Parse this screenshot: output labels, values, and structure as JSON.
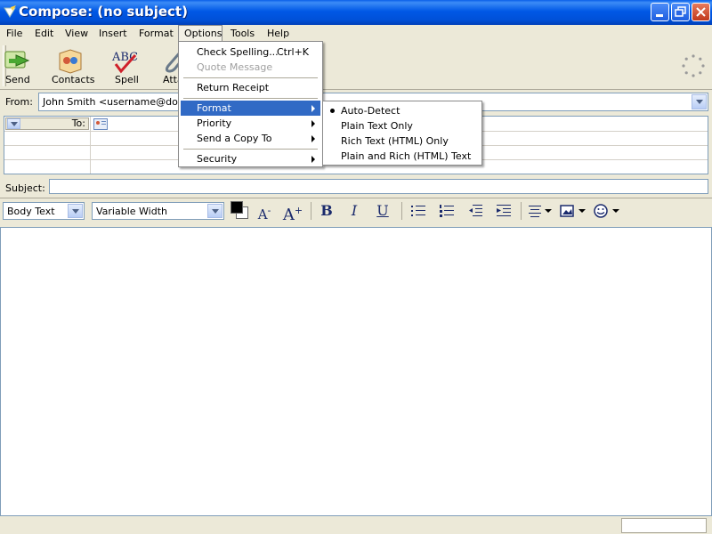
{
  "window": {
    "title": "Compose: (no subject)"
  },
  "menubar": [
    "File",
    "Edit",
    "View",
    "Insert",
    "Format",
    "Options",
    "Tools",
    "Help"
  ],
  "toolbar": {
    "send": "Send",
    "contacts": "Contacts",
    "spell": "Spell",
    "attach": "Atta"
  },
  "from": {
    "label": "From:",
    "value": "John Smith <username@domain"
  },
  "recipients": {
    "type": "To:"
  },
  "subject": {
    "label": "Subject:",
    "value": ""
  },
  "format_bar": {
    "paragraph_style": "Body Text",
    "font": "Variable Width",
    "bold": "B",
    "italic": "I",
    "underline": "U",
    "smaller_text": "A",
    "larger_text": "A"
  },
  "options_menu": {
    "check_spelling": "Check Spelling...",
    "check_spelling_shortcut": "Ctrl+K",
    "quote_message": "Quote Message",
    "return_receipt": "Return Receipt",
    "format": "Format",
    "priority": "Priority",
    "send_copy_to": "Send a Copy To",
    "security": "Security"
  },
  "format_submenu": {
    "auto_detect": "Auto-Detect",
    "plain_text_only": "Plain Text Only",
    "rich_text_only": "Rich Text (HTML) Only",
    "plain_and_rich": "Plain and Rich (HTML) Text",
    "selected": "Auto-Detect"
  }
}
